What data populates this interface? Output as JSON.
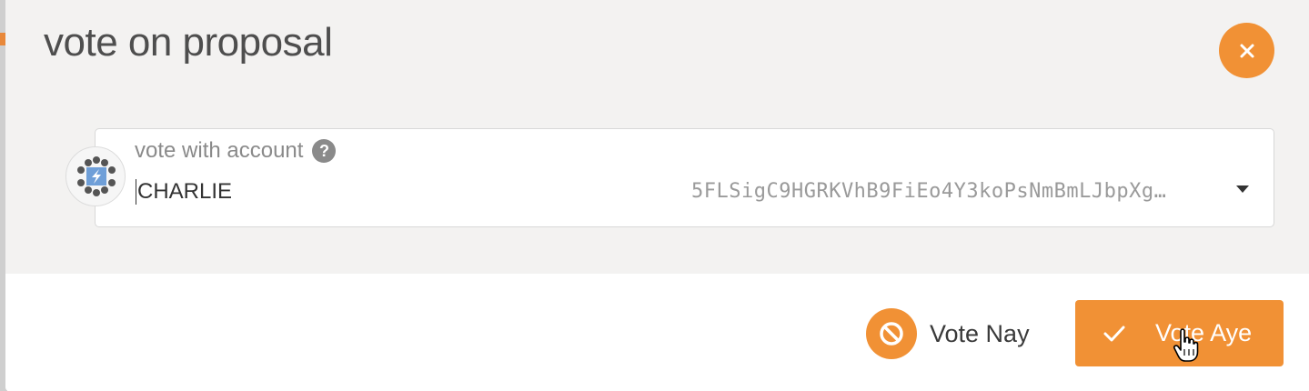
{
  "modal": {
    "title": "vote on proposal",
    "close_icon": "close-icon"
  },
  "account_field": {
    "label": "vote with account",
    "help_icon_glyph": "?",
    "selected_name": "CHARLIE",
    "selected_address": "5FLSigC9HGRKVhB9FiEo4Y3koPsNmBmLJbpXg…",
    "avatar_icon": "identicon-icon",
    "dropdown_icon": "caret-down-icon"
  },
  "actions": {
    "nay_label": "Vote Nay",
    "nay_icon": "ban-icon",
    "aye_label": "Vote Aye",
    "aye_icon": "checkmark-icon"
  },
  "colors": {
    "accent": "#f19135",
    "header_bg": "#f3f2f1"
  }
}
